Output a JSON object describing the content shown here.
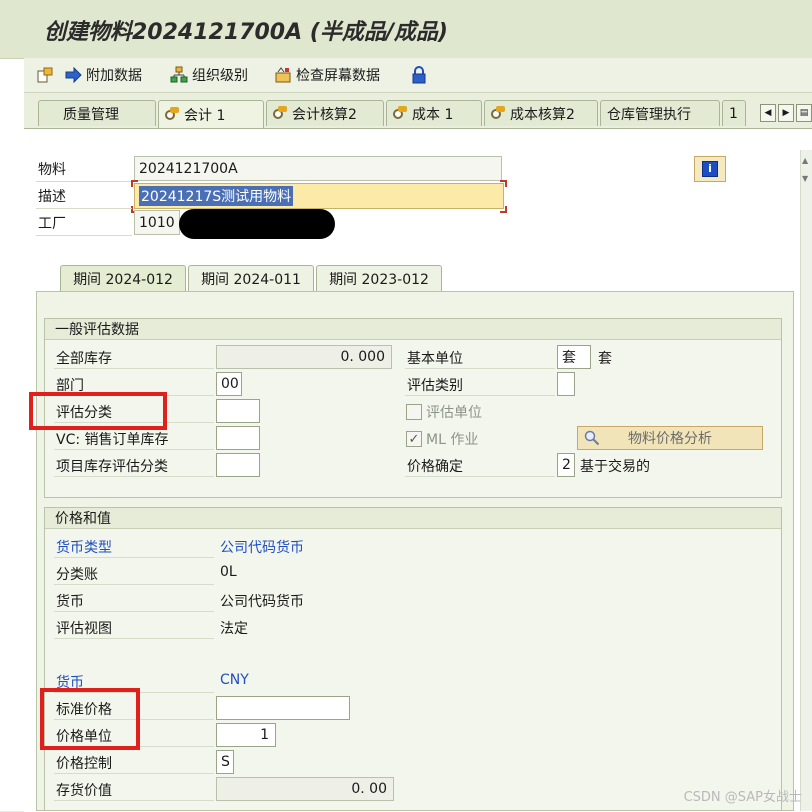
{
  "window": {
    "title": "创建物料2024121700A (半成品/成品)"
  },
  "toolbar": {
    "items": [
      {
        "label": "附加数据"
      },
      {
        "label": "组织级别"
      },
      {
        "label": "检查屏幕数据"
      }
    ]
  },
  "tabs": [
    {
      "label": "质量管理"
    },
    {
      "label": "会计 1"
    },
    {
      "label": "会计核算2"
    },
    {
      "label": "成本 1"
    },
    {
      "label": "成本核算2"
    },
    {
      "label": "仓库管理执行"
    },
    {
      "label": "1"
    }
  ],
  "header": {
    "material_label": "物料",
    "material_value": "2024121700A",
    "desc_label": "描述",
    "desc_value": "20241217S测试用物料",
    "plant_label": "工厂",
    "plant_value": "1010"
  },
  "subtabs": [
    {
      "label": "期间 2024-012"
    },
    {
      "label": "期间 2024-011"
    },
    {
      "label": "期间 2023-012"
    }
  ],
  "general": {
    "title": "一般评估数据",
    "total_stock_label": "全部库存",
    "total_stock_value": "0. 000",
    "base_unit_label": "基本单位",
    "base_unit_value": "套",
    "base_unit_text": "套",
    "division_label": "部门",
    "division_value": "00",
    "valuation_category_label": "评估类别",
    "valuation_class_label": "评估分类",
    "valuation_unit_label": "评估单位",
    "vc_label": "VC: 销售订单库存",
    "ml_label": "ML 作业",
    "analyze_label": "物料价格分析",
    "project_label": "项目库存评估分类",
    "price_det_label": "价格确定",
    "price_det_value": "2",
    "price_det_text": "基于交易的"
  },
  "prices": {
    "title": "价格和值",
    "currency_type_label": "货币类型",
    "currency_type_value": "公司代码货币",
    "ledger_label": "分类账",
    "ledger_value": "0L",
    "currency_label": "货币",
    "currency_value": "公司代码货币",
    "view_label": "评估视图",
    "view_value": "法定",
    "currency2_label": "货币",
    "currency2_value": "CNY",
    "std_price_label": "标准价格",
    "price_unit_label": "价格单位",
    "price_unit_value": "1",
    "price_control_label": "价格控制",
    "price_control_value": "S",
    "inventory_label": "存货价值",
    "inventory_value": "0. 00"
  },
  "watermark": "CSDN @SAP女战士"
}
